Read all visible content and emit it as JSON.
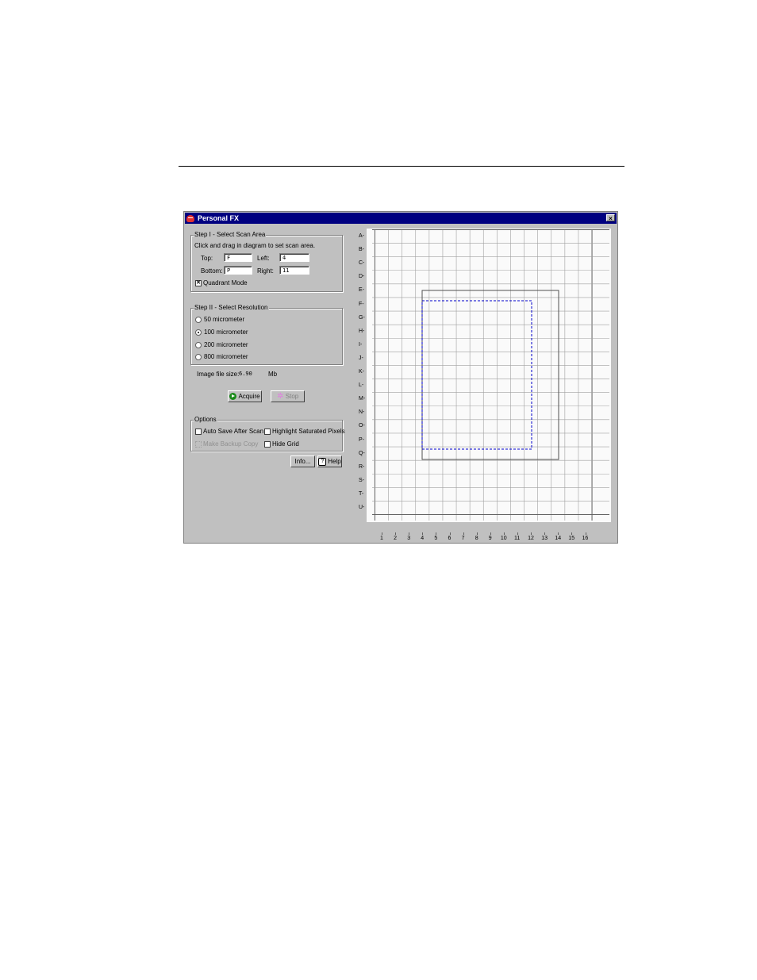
{
  "window": {
    "title": "Personal FX",
    "close_glyph": "×"
  },
  "step1": {
    "legend": "Step I - Select Scan Area",
    "instruction": "Click and drag in diagram to set scan area.",
    "top_label": "Top:",
    "top_value": "F",
    "left_label": "Left:",
    "left_value": "4",
    "bottom_label": "Bottom:",
    "bottom_value": "P",
    "right_label": "Right:",
    "right_value": "11",
    "quadrant_label": "Quadrant Mode",
    "quadrant_checked": true
  },
  "step2": {
    "legend": "Step II - Select Resolution",
    "options": [
      {
        "label": "50 micrometer",
        "selected": false
      },
      {
        "label": "100 micrometer",
        "selected": true
      },
      {
        "label": "200 micrometer",
        "selected": false
      },
      {
        "label": "800 micrometer",
        "selected": false
      }
    ]
  },
  "file_size": {
    "label": "Image file size:",
    "value": "6.90",
    "unit": "Mb"
  },
  "buttons": {
    "acquire": "Acquire",
    "stop": "Stop",
    "info": "Info...",
    "help": "Help"
  },
  "options": {
    "legend": "Options",
    "auto_save": "Auto Save After Scan",
    "highlight": "Highlight Saturated Pixels",
    "backup": "Make Backup Copy",
    "hide_grid": "Hide Grid"
  },
  "grid": {
    "row_labels": [
      "A-",
      "B-",
      "C-",
      "D-",
      "E-",
      "F-",
      "G-",
      "H-",
      "I-",
      "J-",
      "K-",
      "L-",
      "M-",
      "N-",
      "O-",
      "P-",
      "Q-",
      "R-",
      "S-",
      "T-",
      "U-"
    ],
    "col_labels": [
      "1",
      "2",
      "3",
      "4",
      "5",
      "6",
      "7",
      "8",
      "9",
      "10",
      "11",
      "12",
      "13",
      "14",
      "15",
      "16"
    ],
    "selection_color": "#0000cc",
    "line_color": "#808080"
  }
}
